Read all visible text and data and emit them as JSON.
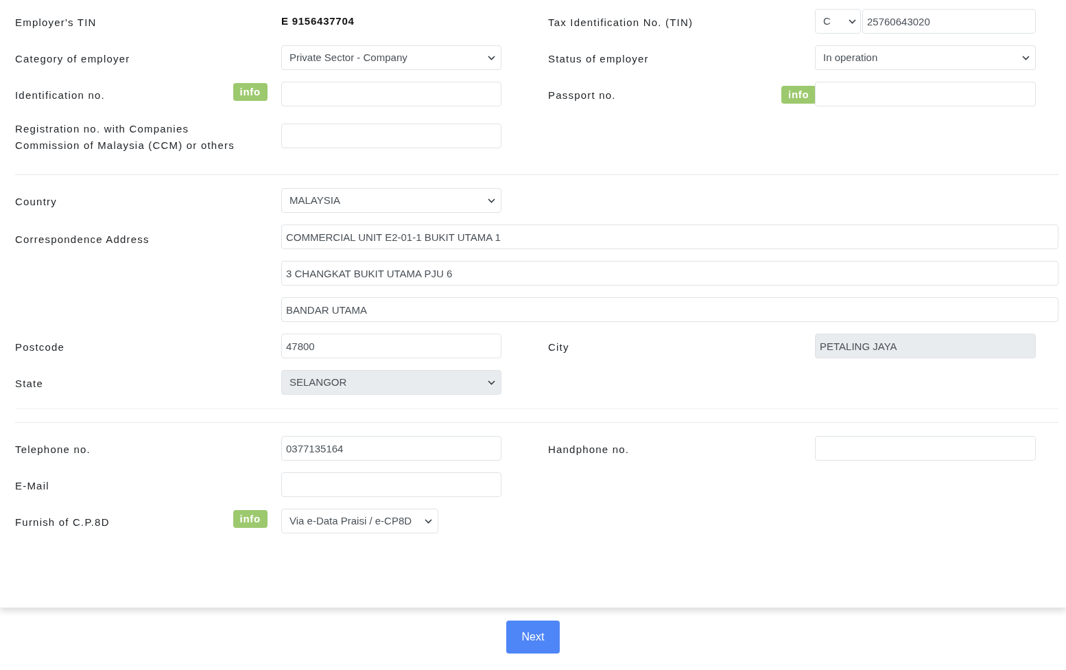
{
  "sections": [
    {
      "rows": [
        {
          "left": {
            "label": "Employer's TIN",
            "kind": "static",
            "value": "E 9156437704"
          },
          "right": {
            "label": "Tax Identification No. (TIN)",
            "kind": "prefixed",
            "prefix": "C",
            "value": "25760643020",
            "disabled": false
          }
        },
        {
          "left": {
            "label": "Category of employer",
            "kind": "select",
            "value": "Private Sector - Company",
            "disabled": false
          },
          "right": {
            "label": "Status of employer",
            "kind": "select",
            "value": "In operation",
            "disabled": false
          }
        },
        {
          "left": {
            "label": "Identification no.",
            "info": "info",
            "kind": "input",
            "disabled": false
          },
          "right": {
            "label": "Passport no.",
            "info": "info",
            "kind": "input",
            "disabled": false
          }
        },
        {
          "left": {
            "label": "Registration no. with Companies Commission of Malaysia (CCM) or others",
            "kind": "input",
            "disabled": false
          }
        }
      ]
    },
    {
      "rows": [
        {
          "left": {
            "label": "Country",
            "kind": "select",
            "value": "MALAYSIA",
            "disabled": false
          }
        },
        {
          "left": {
            "label": "Correspondence Address",
            "kind": "multiline",
            "lines": [
              "COMMERCIAL UNIT E2-01-1 BUKIT UTAMA 1",
              "3 CHANGKAT BUKIT UTAMA PJU 6",
              "BANDAR UTAMA"
            ],
            "disabled": false
          }
        },
        {
          "left": {
            "label": "Postcode",
            "kind": "input",
            "value": "47800",
            "disabled": false
          },
          "right": {
            "label": "City",
            "kind": "input",
            "value": "PETALING JAYA",
            "disabled": true
          }
        },
        {
          "left": {
            "label": "State",
            "kind": "select",
            "value": "SELANGOR",
            "disabled": true
          }
        }
      ]
    },
    {
      "rows": [
        {
          "left": {
            "label": "Telephone no.",
            "kind": "input",
            "value": "0377135164",
            "disabled": false
          },
          "right": {
            "label": "Handphone no.",
            "kind": "input",
            "disabled": false
          }
        },
        {
          "left": {
            "label": "E-Mail",
            "kind": "input",
            "disabled": false
          }
        },
        {
          "left": {
            "label": "Furnish of C.P.8D",
            "info": "info",
            "kind": "select_small",
            "value": "Via e-Data Praisi / e-CP8D",
            "disabled": false
          }
        }
      ]
    }
  ],
  "next_button": "Next"
}
